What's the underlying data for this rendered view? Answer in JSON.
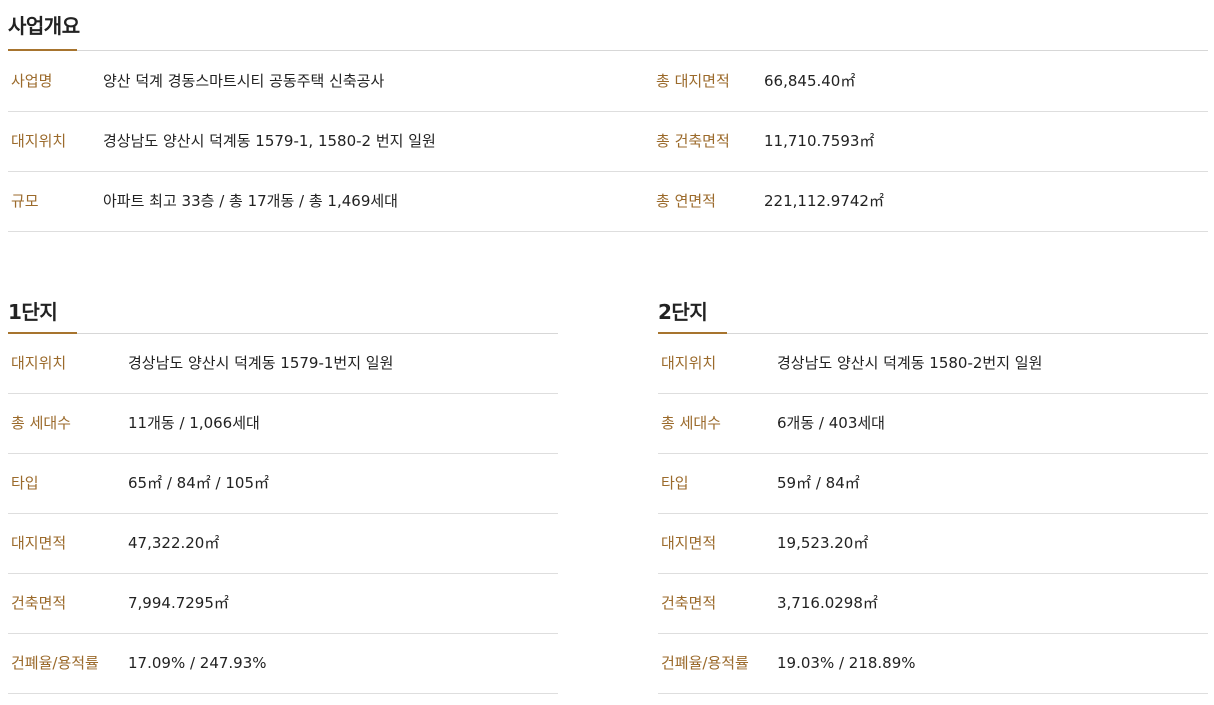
{
  "overview": {
    "title": "사업개요",
    "left_rows": [
      {
        "label": "사업명",
        "value": "양산 덕계 경동스마트시티 공동주택 신축공사"
      },
      {
        "label": "대지위치",
        "value": "경상남도 양산시 덕계동 1579-1, 1580-2 번지 일원"
      },
      {
        "label": "규모",
        "value": "아파트 최고 33층 / 총 17개동 / 총 1,469세대"
      }
    ],
    "right_rows": [
      {
        "label": "총 대지면적",
        "value": "66,845.40㎡"
      },
      {
        "label": "총 건축면적",
        "value": "11,710.7593㎡"
      },
      {
        "label": "총 연면적",
        "value": "221,112.9742㎡"
      }
    ]
  },
  "complex1": {
    "title": "1단지",
    "rows": [
      {
        "label": "대지위치",
        "value": "경상남도 양산시 덕계동 1579-1번지 일원"
      },
      {
        "label": "총 세대수",
        "value": "11개동 / 1,066세대"
      },
      {
        "label": "타입",
        "value": "65㎡ / 84㎡ / 105㎡"
      },
      {
        "label": "대지면적",
        "value": "47,322.20㎡"
      },
      {
        "label": "건축면적",
        "value": "7,994.7295㎡"
      },
      {
        "label": "건폐율/용적률",
        "value": "17.09% / 247.93%"
      }
    ]
  },
  "complex2": {
    "title": "2단지",
    "rows": [
      {
        "label": "대지위치",
        "value": "경상남도 양산시 덕계동 1580-2번지 일원"
      },
      {
        "label": "총 세대수",
        "value": "6개동 / 403세대"
      },
      {
        "label": "타입",
        "value": "59㎡ / 84㎡"
      },
      {
        "label": "대지면적",
        "value": "19,523.20㎡"
      },
      {
        "label": "건축면적",
        "value": "3,716.0298㎡"
      },
      {
        "label": "건폐율/용적률",
        "value": "19.03% / 218.89%"
      }
    ]
  },
  "colors": {
    "accent": "#a7742e",
    "label": "#9b6a2b",
    "divider": "#dedede"
  }
}
